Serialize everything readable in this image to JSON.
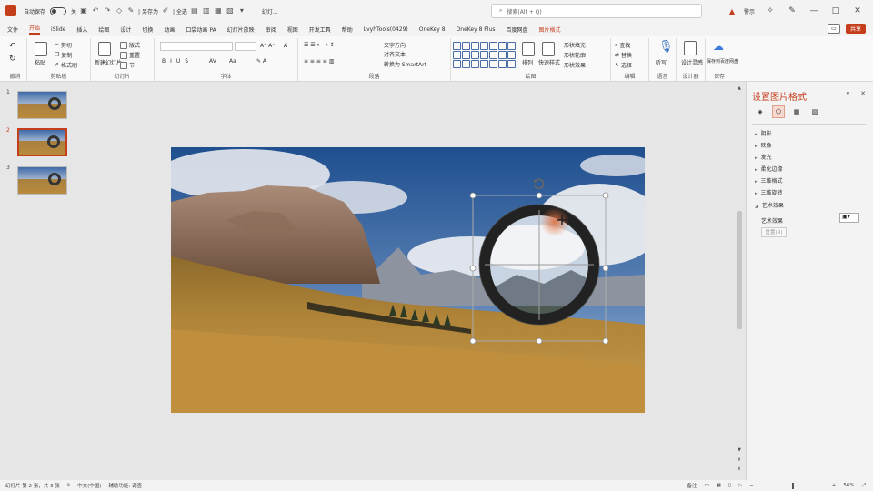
{
  "titlebar": {
    "autosave_label": "自动保存",
    "autosave_state": "关",
    "quick_access": [
      "撤销",
      "重做",
      "|",
      "另存为",
      "格式刷",
      "|",
      "对齐",
      "组合",
      "更多"
    ],
    "separator_text": "| 另存为",
    "align_text": "| 全选",
    "doc_title": "幻灯...",
    "search_placeholder": "搜索(Alt + Q)",
    "warning_text": "警示",
    "icons": [
      "save-icon",
      "undo-icon",
      "redo-icon",
      "search-icon",
      "pen-icon",
      "diamond-icon"
    ]
  },
  "tabs": {
    "items": [
      "文件",
      "开始",
      "iSlide",
      "插入",
      "绘图",
      "设计",
      "切换",
      "动画",
      "口袋动画 PA",
      "幻灯片放映",
      "审阅",
      "视图",
      "开发工具",
      "帮助",
      "LvyhTools(0429)",
      "OneKey 8",
      "OneKey 8 Plus",
      "百度网盘",
      "图片格式"
    ],
    "active_index": 1,
    "share_label": "共享"
  },
  "ribbon": {
    "groups": [
      {
        "label": "撤消"
      },
      {
        "label": "剪贴板"
      },
      {
        "label": "幻灯片"
      },
      {
        "label": "字体"
      },
      {
        "label": "段落"
      },
      {
        "label": "绘图"
      },
      {
        "label": "编辑"
      },
      {
        "label": "语音"
      },
      {
        "label": "设计器"
      },
      {
        "label": "保存"
      }
    ],
    "clipboard": {
      "paste": "粘贴",
      "cut": "剪切",
      "copy": "复制",
      "format": "格式刷"
    },
    "slides": {
      "new": "新建幻灯片",
      "layout": "版式",
      "reset": "重置",
      "section": "节"
    },
    "paragraph": {
      "text_direction": "文字方向",
      "align_text": "对齐文本",
      "smartart": "转换为 SmartArt"
    },
    "drawing": {
      "arrange": "排列",
      "quick_styles": "快速样式",
      "fill": "形状填充",
      "outline": "形状轮廓",
      "effects": "形状效果"
    },
    "editing": {
      "find": "查找",
      "replace": "替换",
      "select": "选择"
    },
    "voice": {
      "dictate": "听写"
    },
    "designer": {
      "ideas": "设计灵感"
    },
    "save": {
      "baidu": "保存到百度网盘"
    }
  },
  "slides": {
    "numbers": [
      "1",
      "2",
      "3"
    ],
    "active_index": 1
  },
  "format_pane": {
    "title": "设置图片格式",
    "sections": [
      "阴影",
      "映像",
      "发光",
      "柔化边缘",
      "三维格式",
      "三维旋转",
      "艺术效果"
    ],
    "expanded_section": "艺术效果",
    "art_effect_label": "艺术效果",
    "reset_label": "重置(R)"
  },
  "statusbar": {
    "slide_info": "幻灯片 第 2 张，共 3 张",
    "language": "中文(中国)",
    "accessibility": "辅助功能: 调查",
    "notes": "备注",
    "zoom": "56%"
  }
}
